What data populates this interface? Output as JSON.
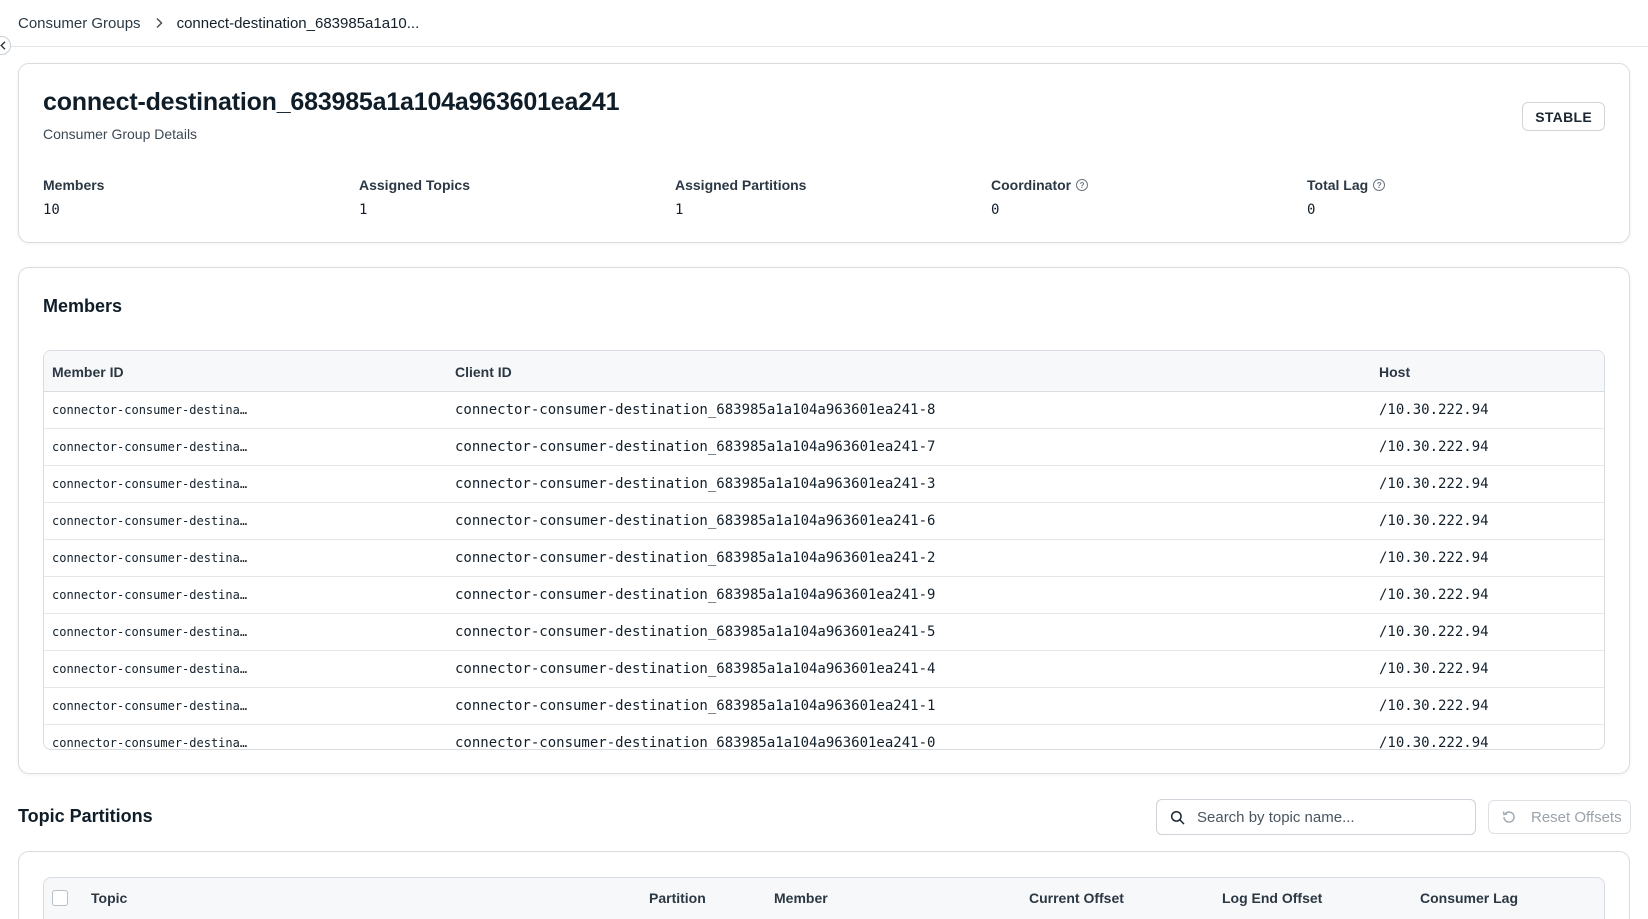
{
  "breadcrumb": {
    "parent": "Consumer Groups",
    "current": "connect-destination_683985a1a10..."
  },
  "group": {
    "title": "connect-destination_683985a1a104a963601ea241",
    "subtitle": "Consumer Group Details",
    "state": "STABLE"
  },
  "stats": [
    {
      "label": "Members",
      "value": "10",
      "help": false
    },
    {
      "label": "Assigned Topics",
      "value": "1",
      "help": false
    },
    {
      "label": "Assigned Partitions",
      "value": "1",
      "help": false
    },
    {
      "label": "Coordinator",
      "value": "0",
      "help": true
    },
    {
      "label": "Total Lag",
      "value": "0",
      "help": true
    }
  ],
  "members": {
    "title": "Members",
    "columns": [
      "Member ID",
      "Client ID",
      "Host"
    ],
    "rows": [
      {
        "member_id": "connector-consumer-destina…",
        "client_id": "connector-consumer-destination_683985a1a104a963601ea241-8",
        "host": "/10.30.222.94"
      },
      {
        "member_id": "connector-consumer-destina…",
        "client_id": "connector-consumer-destination_683985a1a104a963601ea241-7",
        "host": "/10.30.222.94"
      },
      {
        "member_id": "connector-consumer-destina…",
        "client_id": "connector-consumer-destination_683985a1a104a963601ea241-3",
        "host": "/10.30.222.94"
      },
      {
        "member_id": "connector-consumer-destina…",
        "client_id": "connector-consumer-destination_683985a1a104a963601ea241-6",
        "host": "/10.30.222.94"
      },
      {
        "member_id": "connector-consumer-destina…",
        "client_id": "connector-consumer-destination_683985a1a104a963601ea241-2",
        "host": "/10.30.222.94"
      },
      {
        "member_id": "connector-consumer-destina…",
        "client_id": "connector-consumer-destination_683985a1a104a963601ea241-9",
        "host": "/10.30.222.94"
      },
      {
        "member_id": "connector-consumer-destina…",
        "client_id": "connector-consumer-destination_683985a1a104a963601ea241-5",
        "host": "/10.30.222.94"
      },
      {
        "member_id": "connector-consumer-destina…",
        "client_id": "connector-consumer-destination_683985a1a104a963601ea241-4",
        "host": "/10.30.222.94"
      },
      {
        "member_id": "connector-consumer-destina…",
        "client_id": "connector-consumer-destination_683985a1a104a963601ea241-1",
        "host": "/10.30.222.94"
      },
      {
        "member_id": "connector-consumer-destina…",
        "client_id": "connector-consumer-destination_683985a1a104a963601ea241-0",
        "host": "/10.30.222.94"
      }
    ]
  },
  "topic_partitions": {
    "title": "Topic Partitions",
    "search_placeholder": "Search by topic name...",
    "reset_label": "Reset Offsets",
    "columns": [
      "Topic",
      "Partition",
      "Member",
      "Current Offset",
      "Log End Offset",
      "Consumer Lag"
    ]
  }
}
